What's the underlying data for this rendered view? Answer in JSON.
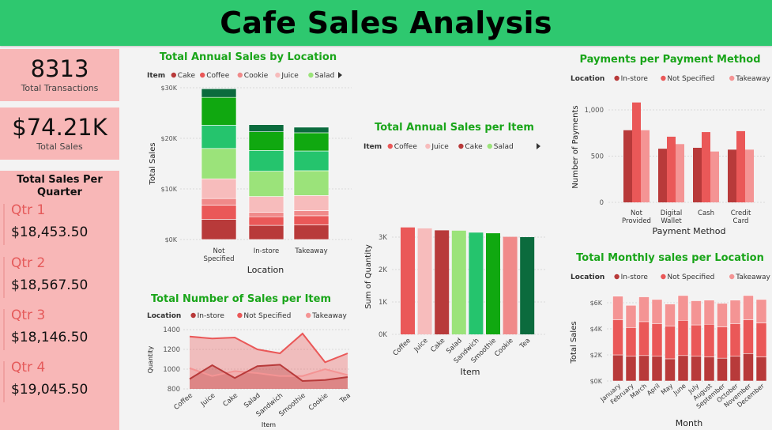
{
  "header": {
    "title": "Cafe Sales Analysis"
  },
  "kpis": {
    "transactions_value": "8313",
    "transactions_label": "Total Transactions",
    "sales_value": "$74.21K",
    "sales_label": "Total Sales"
  },
  "quarters": {
    "title": "Total Sales Per Quarter",
    "items": [
      {
        "name": "Qtr 1",
        "value": "$18,453.50"
      },
      {
        "name": "Qtr 2",
        "value": "$18,567.50"
      },
      {
        "name": "Qtr 3",
        "value": "$18,146.50"
      },
      {
        "name": "Qtr 4",
        "value": "$19,045.50"
      }
    ]
  },
  "colors": {
    "cake": "#b83a3a",
    "coffee": "#ea5858",
    "cookie": "#f08a8a",
    "juice": "#f7bcbc",
    "salad": "#9be37a",
    "sandwich": "#25c46d",
    "smoothie": "#10a810",
    "tea": "#0b6b3d",
    "instore": "#b83a3a",
    "notspecified": "#ea5858",
    "takeaway": "#f49494",
    "title_green": "#19a519"
  },
  "chart_data": [
    {
      "id": "location_stack",
      "type": "bar",
      "stacked": true,
      "title": "Total Annual Sales by Location",
      "legend_title": "Item",
      "legend_items": [
        "Cake",
        "Coffee",
        "Cookie",
        "Juice",
        "Salad"
      ],
      "xlabel": "Location",
      "ylabel": "Total Sales",
      "categories": [
        "Not Specified",
        "In-store",
        "Takeaway"
      ],
      "y_ticks": [
        "$0K",
        "$10K",
        "$20K",
        "$30K"
      ],
      "ylim": [
        0,
        30000
      ],
      "series": [
        {
          "name": "Cake",
          "color": "#b83a3a",
          "values": [
            4000,
            2800,
            2900
          ]
        },
        {
          "name": "Coffee",
          "color": "#ea5858",
          "values": [
            2800,
            1700,
            1800
          ]
        },
        {
          "name": "Cookie",
          "color": "#f08a8a",
          "values": [
            1300,
            900,
            1000
          ]
        },
        {
          "name": "Juice",
          "color": "#f7bcbc",
          "values": [
            3900,
            3100,
            3000
          ]
        },
        {
          "name": "Salad",
          "color": "#9be37a",
          "values": [
            6000,
            5000,
            4900
          ]
        },
        {
          "name": "Sandwich",
          "color": "#25c46d",
          "values": [
            4600,
            4100,
            3900
          ]
        },
        {
          "name": "Smoothie",
          "color": "#10a810",
          "values": [
            5500,
            3700,
            3600
          ]
        },
        {
          "name": "Tea",
          "color": "#0b6b3d",
          "values": [
            1700,
            1400,
            1100
          ]
        }
      ]
    },
    {
      "id": "item_count",
      "type": "area",
      "title": "Total Number of Sales per Item",
      "legend_title": "Location",
      "legend_items": [
        "In-store",
        "Not Specified",
        "Takeaway"
      ],
      "xlabel": "Item",
      "ylabel": "Quantity",
      "categories": [
        "Coffee",
        "Juice",
        "Cake",
        "Salad",
        "Sandwich",
        "Smoothie",
        "Cookie",
        "Tea"
      ],
      "y_ticks": [
        800,
        1000,
        1200,
        1400
      ],
      "ylim": [
        800,
        1450
      ],
      "series": [
        {
          "name": "In-store",
          "color": "#b83a3a",
          "values": [
            900,
            1040,
            910,
            1030,
            1045,
            880,
            890,
            920
          ]
        },
        {
          "name": "Not Specified",
          "color": "#ea5858",
          "values": [
            1330,
            1310,
            1320,
            1200,
            1160,
            1360,
            1070,
            1160
          ]
        },
        {
          "name": "Takeaway",
          "color": "#f49494",
          "values": [
            1010,
            930,
            980,
            960,
            930,
            930,
            1000,
            940
          ]
        }
      ]
    },
    {
      "id": "item_quantity",
      "type": "bar",
      "title": "Total Annual Sales per Item",
      "legend_title": "Item",
      "legend_items": [
        "Coffee",
        "Juice",
        "Cake",
        "Salad"
      ],
      "xlabel": "Item",
      "ylabel": "Sum of Quantity",
      "categories": [
        "Coffee",
        "Juice",
        "Cake",
        "Salad",
        "Sandwich",
        "Smoothie",
        "Cookie",
        "Tea"
      ],
      "colors": [
        "#ea5858",
        "#f7bcbc",
        "#b83a3a",
        "#9be37a",
        "#25c46d",
        "#10a810",
        "#f08a8a",
        "#0b6b3d"
      ],
      "values": [
        3300,
        3270,
        3210,
        3200,
        3140,
        3120,
        3010,
        3000
      ],
      "y_ticks": [
        "0K",
        "1K",
        "2K",
        "3K"
      ],
      "ylim": [
        0,
        3500
      ]
    },
    {
      "id": "payments",
      "type": "bar",
      "title": "Payments per Payment Method",
      "legend_title": "Location",
      "legend_items": [
        "In-store",
        "Not Specified",
        "Takeaway"
      ],
      "xlabel": "Payment Method",
      "ylabel": "Number of Payments",
      "categories": [
        "Not Provided",
        "Digital Wallet",
        "Cash",
        "Credit Card"
      ],
      "y_ticks": [
        "0",
        "500",
        "1,000"
      ],
      "ylim": [
        0,
        1100
      ],
      "series": [
        {
          "name": "In-store",
          "color": "#b83a3a",
          "values": [
            780,
            580,
            590,
            570
          ]
        },
        {
          "name": "Not Specified",
          "color": "#ea5858",
          "values": [
            1080,
            710,
            760,
            770
          ]
        },
        {
          "name": "Takeaway",
          "color": "#f49494",
          "values": [
            780,
            630,
            550,
            570
          ]
        }
      ]
    },
    {
      "id": "monthly",
      "type": "bar",
      "stacked": true,
      "title": "Total Monthly sales per Location",
      "legend_title": "Location",
      "legend_items": [
        "In-store",
        "Not Specified",
        "Takeaway"
      ],
      "xlabel": "Month",
      "ylabel": "Total Sales",
      "categories": [
        "January",
        "February",
        "March",
        "April",
        "May",
        "June",
        "July",
        "August",
        "September",
        "October",
        "November",
        "December"
      ],
      "y_ticks": [
        "$0K",
        "$2K",
        "$4K",
        "$6K"
      ],
      "ylim": [
        0,
        7000
      ],
      "series": [
        {
          "name": "In-store",
          "color": "#b83a3a",
          "values": [
            2000,
            1900,
            1950,
            1900,
            1700,
            1950,
            1900,
            1850,
            1750,
            1900,
            2100,
            1850
          ]
        },
        {
          "name": "Not Specified",
          "color": "#ea5858",
          "values": [
            2700,
            2200,
            2600,
            2500,
            2500,
            2700,
            2400,
            2500,
            2400,
            2500,
            2600,
            2600
          ]
        },
        {
          "name": "Takeaway",
          "color": "#f49494",
          "values": [
            1800,
            1700,
            1900,
            1850,
            1700,
            1900,
            1850,
            1850,
            1800,
            1800,
            1850,
            1800
          ]
        }
      ]
    }
  ]
}
